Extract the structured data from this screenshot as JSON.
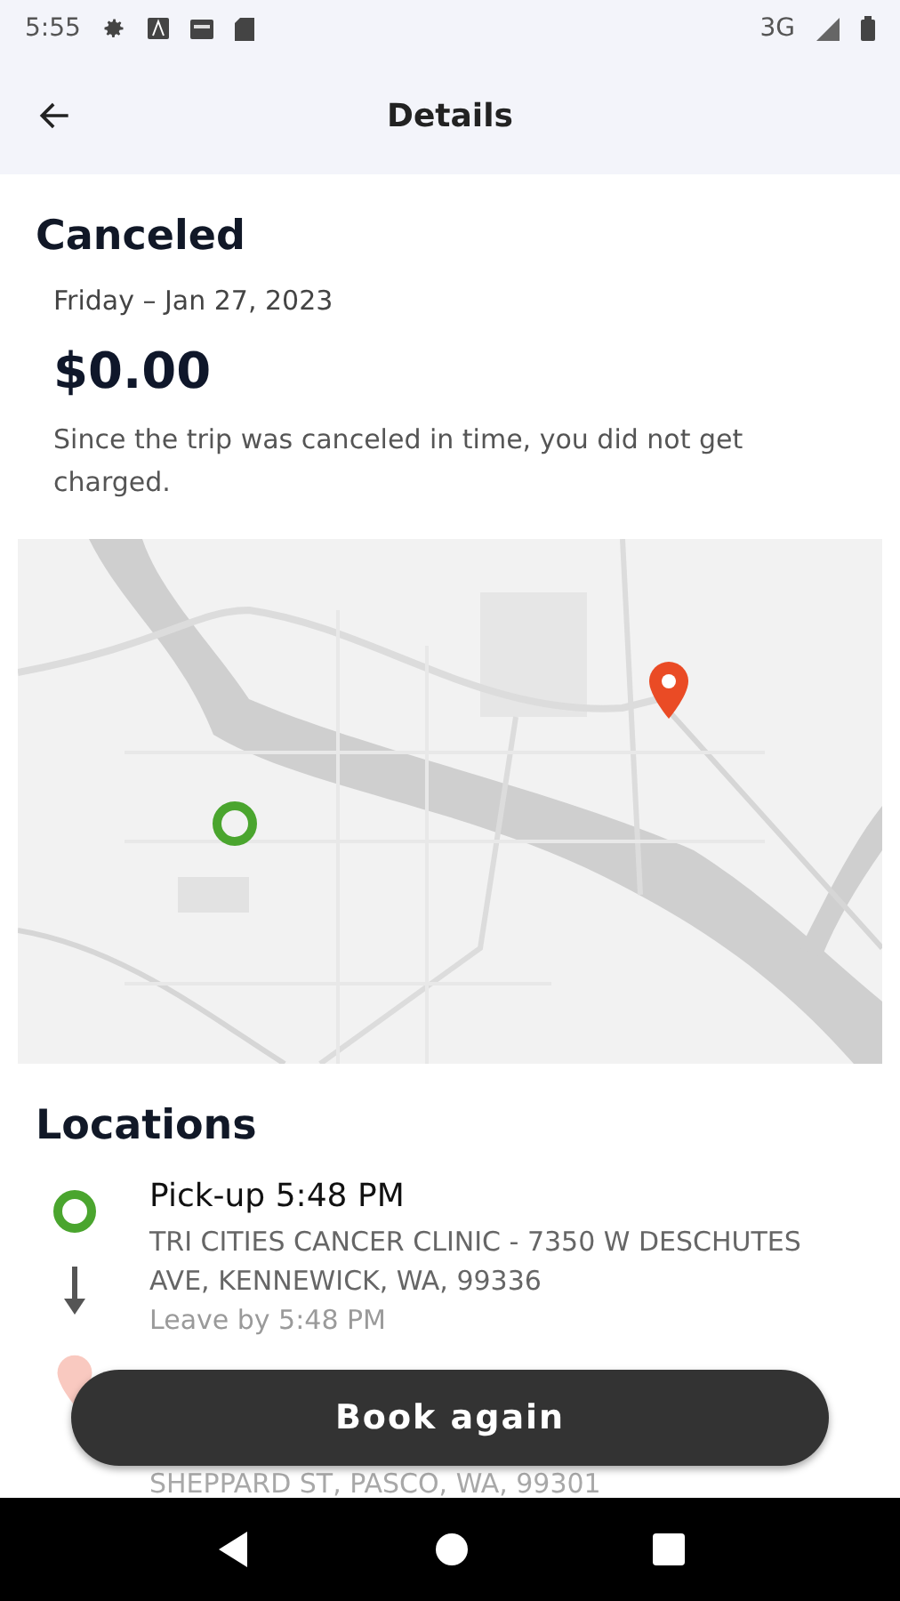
{
  "status_bar": {
    "time": "5:55",
    "network": "3G"
  },
  "header": {
    "title": "Details"
  },
  "trip": {
    "status": "Canceled",
    "date": "Friday – Jan 27, 2023",
    "price": "$0.00",
    "note": "Since the trip was canceled in time, you did not get charged."
  },
  "locations": {
    "title": "Locations",
    "items": [
      {
        "kind": "pickup",
        "title": "Pick-up 5:48 PM",
        "address": "TRI CITIES CANCER CLINIC - 7350 W DESCHUTES AVE, KENNEWICK, WA, 99336",
        "note": "Leave by 5:48 PM"
      },
      {
        "kind": "dropoff",
        "address": "SHEPPARD ST, PASCO, WA, 99301"
      }
    ]
  },
  "book_button": "Book again"
}
